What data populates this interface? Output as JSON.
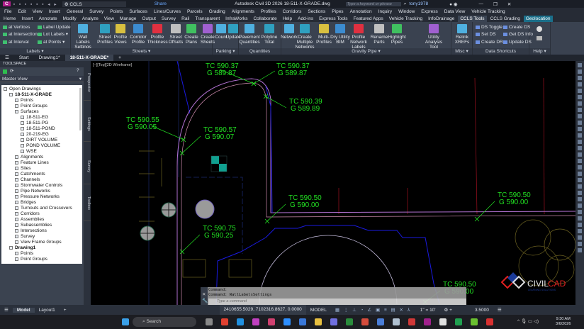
{
  "title_bar": {
    "app_button": "C",
    "workspace": "CCLS",
    "share": "Share",
    "title": "Autodesk Civil 3D 2026   18-511-X-GRADE.dwg",
    "search_placeholder": "Type a keyword or phrase",
    "user": "tony1978"
  },
  "menu_bar": [
    "File",
    "Edit",
    "View",
    "Insert",
    "General",
    "Survey",
    "Points",
    "Surfaces",
    "Lines/Curves",
    "Parcels",
    "Grading",
    "Alignments",
    "Profiles",
    "Corridors",
    "Sections",
    "Pipes",
    "Annotation",
    "Inquiry",
    "Window",
    "Express",
    "Data View",
    "Vehicle Tracking"
  ],
  "ribbon_tabs": [
    "Home",
    "Insert",
    "Annotate",
    "Modify",
    "Analyze",
    "View",
    "Manage",
    "Output",
    "Survey",
    "Rail",
    "Transparent",
    "InfraWorks",
    "Collaborate",
    "Help",
    "Add-ins",
    "Express Tools",
    "Featured Apps",
    "Vehicle Tracking",
    "InfoDrainage",
    "CCLS Tools",
    "CCLS Grading",
    "Geolocation"
  ],
  "active_tab": "CCLS Tools",
  "ribbon": {
    "labels_panel": {
      "title": "Labels ▾",
      "items": [
        "at Vertices",
        "at Intersection",
        "at Interval",
        "Label Update",
        "Lot Labels ▾",
        "at Points ▾"
      ]
    },
    "streets_panel": {
      "title": "Streets ▾",
      "items": [
        "Wall Labels Settings",
        "Street Profiles",
        "Profile Views",
        "Corridor Profile",
        "Profile Thickness",
        "Street Offsets",
        "Create Plans",
        "Create Sheets"
      ]
    },
    "parking_panel": {
      "title": "Parking ▾",
      "items": [
        "Count",
        "Update"
      ]
    },
    "quantities_panel": {
      "title": "Quantities",
      "items": [
        "Pavement Quantities",
        "Polyline Total"
      ]
    },
    "gravity_pipe_panel": {
      "title": "Gravity Pipe ▾",
      "items": [
        "Network",
        "Create Multiple Networks",
        "Multi-Profiles",
        "Dry Utility BIM",
        "Profile Network Labels",
        "Rename Parts",
        "Highlight Pipes",
        "Utility Analysis Tool"
      ]
    },
    "misc_panel": {
      "title": "Misc ▾",
      "items": [
        "Relink XREFs"
      ]
    },
    "data_shortcuts_panel": {
      "title": "Data Shortcuts",
      "items": [
        "DS Toggle",
        "Set DS",
        "Create DR",
        "Create DS",
        "Get DS Info",
        "Update DS"
      ]
    },
    "help_panel": {
      "title": "Help ▾"
    }
  },
  "file_tabs": [
    "Start",
    "Drawing1*",
    "18-511-X-GRADE*"
  ],
  "toolspace": {
    "title": "TOOLSPACE",
    "view": "Master View",
    "tree": [
      {
        "level": 0,
        "label": "Open Drawings"
      },
      {
        "level": 1,
        "label": "18-511-X-GRADE"
      },
      {
        "level": 2,
        "label": "Points"
      },
      {
        "level": 2,
        "label": "Point Groups"
      },
      {
        "level": 2,
        "label": "Surfaces"
      },
      {
        "level": 3,
        "label": "18-511-EG"
      },
      {
        "level": 3,
        "label": "18-511-PG"
      },
      {
        "level": 3,
        "label": "18-511-POND"
      },
      {
        "level": 3,
        "label": "20-219-EG"
      },
      {
        "level": 3,
        "label": "DIRT VOLUME"
      },
      {
        "level": 3,
        "label": "POND VOLUME"
      },
      {
        "level": 3,
        "label": "WSE"
      },
      {
        "level": 2,
        "label": "Alignments"
      },
      {
        "level": 2,
        "label": "Feature Lines"
      },
      {
        "level": 2,
        "label": "Sites"
      },
      {
        "level": 2,
        "label": "Catchments"
      },
      {
        "level": 2,
        "label": "Channels"
      },
      {
        "level": 2,
        "label": "Stormwater Controls"
      },
      {
        "level": 2,
        "label": "Pipe Networks"
      },
      {
        "level": 2,
        "label": "Pressure Networks"
      },
      {
        "level": 2,
        "label": "Bridges"
      },
      {
        "level": 2,
        "label": "Turnouts and Crossovers"
      },
      {
        "level": 2,
        "label": "Corridors"
      },
      {
        "level": 2,
        "label": "Assemblies"
      },
      {
        "level": 2,
        "label": "Subassemblies"
      },
      {
        "level": 2,
        "label": "Intersections"
      },
      {
        "level": 2,
        "label": "Survey"
      },
      {
        "level": 2,
        "label": "View Frame Groups"
      },
      {
        "level": 1,
        "label": "Drawing1"
      },
      {
        "level": 2,
        "label": "Points"
      },
      {
        "level": 2,
        "label": "Point Groups"
      }
    ]
  },
  "side_tabs": [
    "Prospector",
    "Settings",
    "Survey",
    "Toolbox"
  ],
  "viewport_label": "[−][Top][2D Wireframe]",
  "drawing": {
    "labels": [
      {
        "tc": "TC 590.37",
        "g": "G 589.87"
      },
      {
        "tc": "TC 590.37",
        "g": "G 589.87"
      },
      {
        "tc": "TC 590.39",
        "g": "G 589.89"
      },
      {
        "tc": "TC 590.55",
        "g": "G 590.05"
      },
      {
        "tc": "TC 590.57",
        "g": "G 590.07"
      },
      {
        "tc": "TC 590.50",
        "g": "G 590.00"
      },
      {
        "tc": "TC 590.75",
        "g": "G 590.25"
      },
      {
        "tc": "TC 590.50",
        "g": "G 590.00"
      },
      {
        "tc": "TC 590.50",
        "g": "G 590.00"
      }
    ],
    "logo": {
      "text1": "CIVIL",
      "text2": "CAD",
      "tagline": "LEARNING SOLUTIONS"
    },
    "colors": {
      "label": "#22e022",
      "curb": "#b070d0",
      "boundary": "#1a1ae0",
      "red": "#a01020"
    }
  },
  "command_line": {
    "history": [
      "Command:",
      "Command: WallLabelsSettings"
    ],
    "placeholder": "Type a command"
  },
  "layout_tabs": [
    "Model",
    "Layout1"
  ],
  "status": {
    "coords": "2410655.5029, 7102316.8627, 0.0000",
    "space": "MODEL",
    "scale": "1\" = 10'",
    "value": "3.5000"
  },
  "taskbar": {
    "search": "Search",
    "time": "9:30 AM",
    "date": "3/6/2026"
  }
}
